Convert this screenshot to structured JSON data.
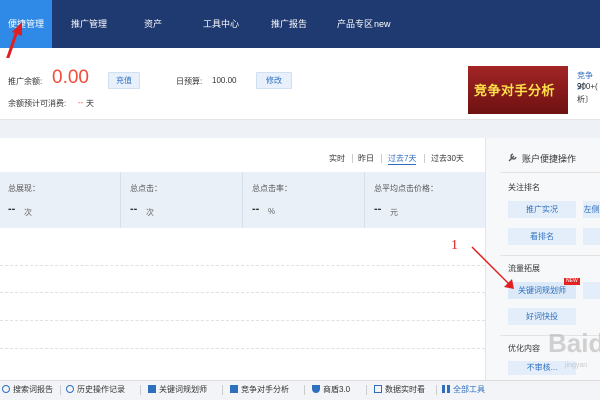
{
  "nav": {
    "tabs": [
      {
        "label": "便捷管理",
        "active": true
      },
      {
        "label": "推广管理"
      },
      {
        "label": "资产"
      },
      {
        "label": "工具中心"
      },
      {
        "label": "推广报告"
      },
      {
        "label": "产品专区",
        "badge": "new"
      }
    ]
  },
  "balance": {
    "label": "推广余额:",
    "amount": "0.00",
    "recharge": "充值",
    "days_label": "余额预计可消费:",
    "days_value": "--",
    "days_unit": "天",
    "budget_label": "日预算:",
    "budget_value": "100.00",
    "modify": "修改"
  },
  "promo": {
    "banner_text": "竞争对手分析",
    "side_title": "竞争对",
    "side_line2": "900+(",
    "side_line3": "析〕"
  },
  "ranges": {
    "realtime": "实时",
    "yesterday": "昨日",
    "last7": "过去7天",
    "last30": "过去30天"
  },
  "stats": [
    {
      "label": "总展现：",
      "value": "--",
      "unit": "次"
    },
    {
      "label": "总点击：",
      "value": "--",
      "unit": "次"
    },
    {
      "label": "总点击率：",
      "value": "--",
      "unit": "%"
    },
    {
      "label": "总平均点击价格：",
      "value": "--",
      "unit": "元"
    }
  ],
  "panel": {
    "title": "账户便捷操作",
    "sections": {
      "rank": "关注排名",
      "traffic": "流量拓展",
      "optimize": "优化内容"
    },
    "buttons": {
      "promo_live": "推广实况",
      "left_cut": "左侧",
      "view_rank": "看排名",
      "keyword_planner": "关键词规划师",
      "good_word": "好词快投",
      "not_review": "不审核..."
    },
    "new_badge": "NEW"
  },
  "annotation": {
    "number": "1"
  },
  "watermark": {
    "logo": "Baid",
    "sub": "jingyan"
  },
  "toolbar": {
    "items": [
      {
        "label": "搜索词报告",
        "icon": "search-report-icon"
      },
      {
        "label": "历史操作记录",
        "icon": "history-icon"
      },
      {
        "label": "关键词规划师",
        "icon": "keyword-planner-icon"
      },
      {
        "label": "竞争对手分析",
        "icon": "competitor-icon"
      },
      {
        "label": "商盾3.0",
        "icon": "shield-icon"
      },
      {
        "label": "数据实时看",
        "icon": "realtime-data-icon"
      },
      {
        "label": "全部工具",
        "icon": "grid-icon"
      }
    ]
  },
  "colors": {
    "nav_bg": "#1f3a70",
    "nav_active": "#2e8ae6",
    "accent_red": "#f04d3c",
    "link_blue": "#2f6fbf"
  }
}
